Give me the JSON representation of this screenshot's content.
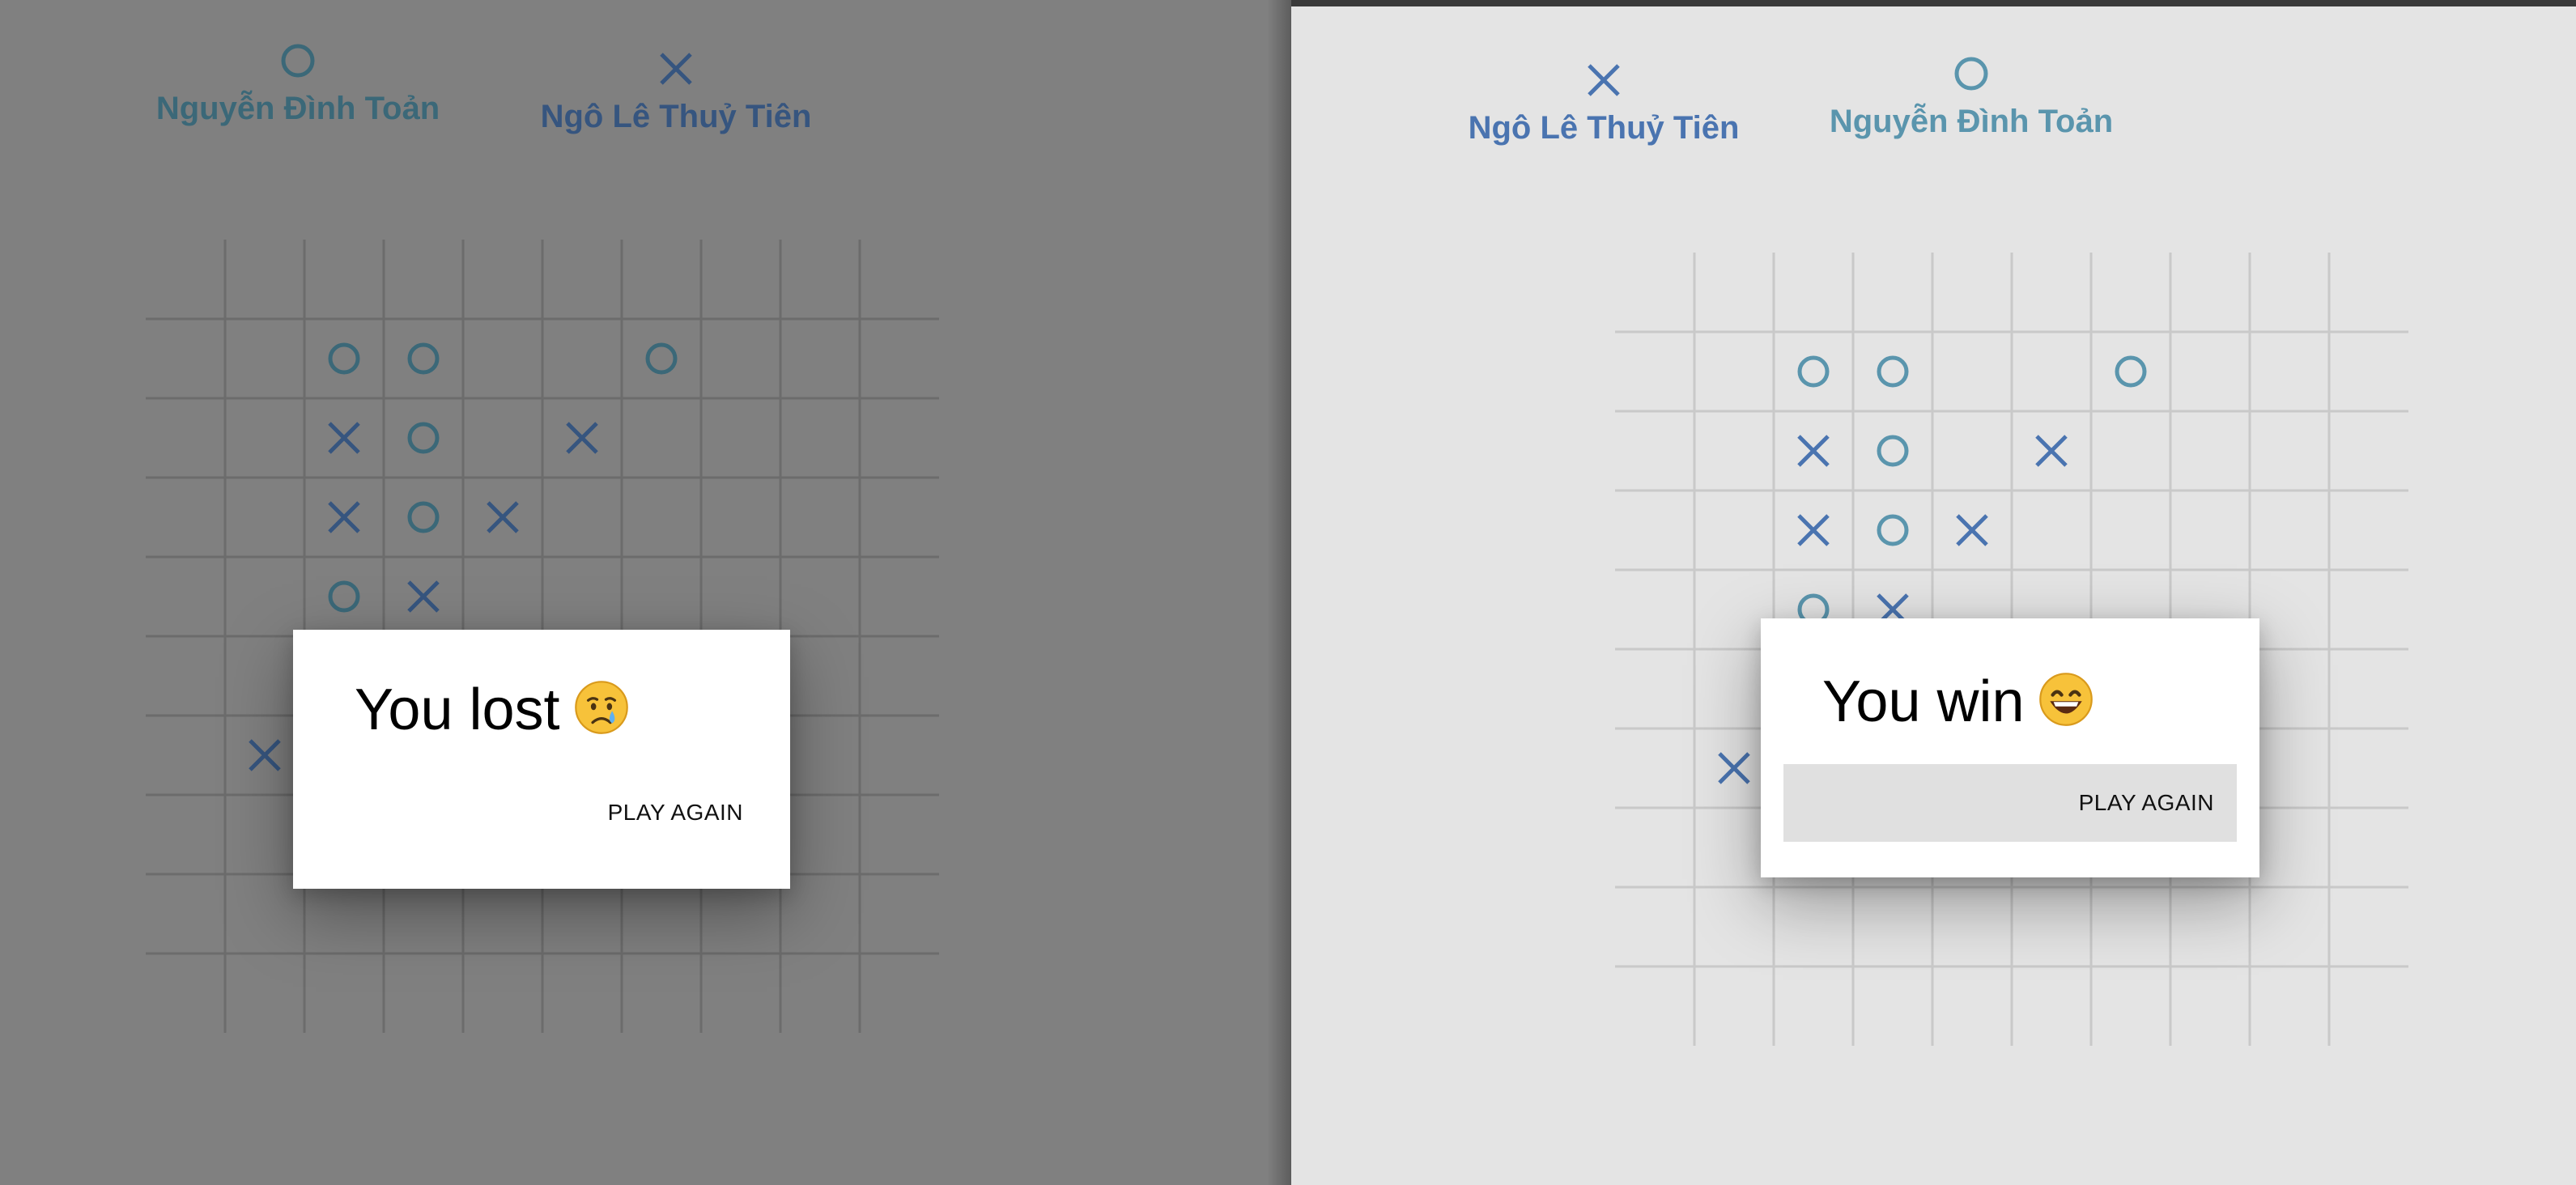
{
  "colors": {
    "x_mark": "#4a74b0",
    "o_mark": "#5a95ad",
    "left_overlay": "#808080",
    "right_bg": "#e4e4e4"
  },
  "left_window": {
    "players": [
      {
        "symbol": "O",
        "name": "Nguyễn Đình Toản",
        "name_color": "#3b6878",
        "icon": "circle-icon"
      },
      {
        "symbol": "X",
        "name": "Ngô Lê Thuỷ Tiên",
        "name_color": "#36557f",
        "icon": "cross-icon"
      }
    ],
    "board": {
      "cols": 10,
      "rows": 10,
      "marks": [
        {
          "r": 1,
          "c": 2,
          "v": "O"
        },
        {
          "r": 1,
          "c": 3,
          "v": "O"
        },
        {
          "r": 1,
          "c": 6,
          "v": "O"
        },
        {
          "r": 2,
          "c": 2,
          "v": "X"
        },
        {
          "r": 2,
          "c": 3,
          "v": "O"
        },
        {
          "r": 2,
          "c": 5,
          "v": "X"
        },
        {
          "r": 3,
          "c": 2,
          "v": "X"
        },
        {
          "r": 3,
          "c": 3,
          "v": "O"
        },
        {
          "r": 3,
          "c": 4,
          "v": "X"
        },
        {
          "r": 4,
          "c": 2,
          "v": "O"
        },
        {
          "r": 4,
          "c": 3,
          "v": "X"
        },
        {
          "r": 6,
          "c": 1,
          "v": "X"
        }
      ]
    },
    "dialog": {
      "title": "You lost",
      "emoji": "crying-face-icon",
      "button_label": "PLAY AGAIN"
    }
  },
  "right_window": {
    "players": [
      {
        "symbol": "X",
        "name": "Ngô Lê Thuỷ Tiên",
        "name_color": "#4a74b0",
        "icon": "cross-icon"
      },
      {
        "symbol": "O",
        "name": "Nguyễn Đình Toản",
        "name_color": "#5a95ad",
        "icon": "circle-icon"
      }
    ],
    "board": {
      "cols": 10,
      "rows": 10,
      "marks": [
        {
          "r": 1,
          "c": 2,
          "v": "O"
        },
        {
          "r": 1,
          "c": 3,
          "v": "O"
        },
        {
          "r": 1,
          "c": 6,
          "v": "O"
        },
        {
          "r": 2,
          "c": 2,
          "v": "X"
        },
        {
          "r": 2,
          "c": 3,
          "v": "O"
        },
        {
          "r": 2,
          "c": 5,
          "v": "X"
        },
        {
          "r": 3,
          "c": 2,
          "v": "X"
        },
        {
          "r": 3,
          "c": 3,
          "v": "O"
        },
        {
          "r": 3,
          "c": 4,
          "v": "X"
        },
        {
          "r": 4,
          "c": 2,
          "v": "O"
        },
        {
          "r": 4,
          "c": 3,
          "v": "X"
        },
        {
          "r": 6,
          "c": 1,
          "v": "X"
        }
      ]
    },
    "dialog": {
      "title": "You win",
      "emoji": "grinning-face-icon",
      "button_label": "PLAY AGAIN"
    }
  }
}
